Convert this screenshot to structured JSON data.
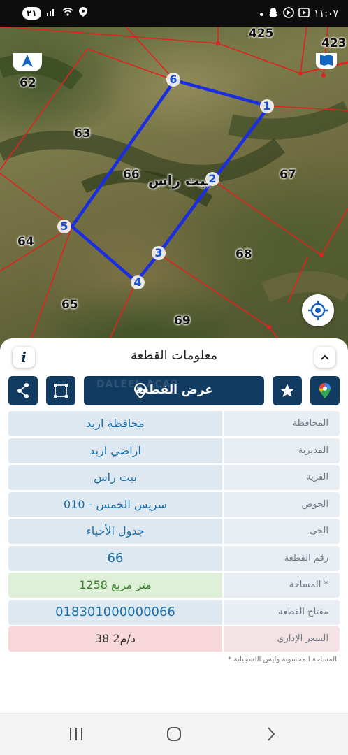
{
  "status_bar": {
    "notification_count": "٢١",
    "time": "١١:٠٧"
  },
  "map": {
    "parcels": [
      "62",
      "63",
      "64",
      "65",
      "66",
      "67",
      "68",
      "69",
      "425",
      "423"
    ],
    "village_label": "بيت راس",
    "vertices": [
      "1",
      "2",
      "3",
      "4",
      "5",
      "6"
    ],
    "highlight_color": "#1a2de0",
    "boundary_color": "#e0231e"
  },
  "sheet": {
    "title": "معلومات القطعة",
    "show_parcel_button": "عرض القطعة",
    "watermark": "DALEEL ACAR",
    "rows": [
      {
        "label": "المحافظة",
        "value": "محافظة اربد"
      },
      {
        "label": "المديرية",
        "value": "اراضي اربد"
      },
      {
        "label": "القرية",
        "value": "بيت راس"
      },
      {
        "label": "الحوض",
        "value": "سريس  الخمس - 010"
      },
      {
        "label": "الحي",
        "value": "جدول الأحياء"
      },
      {
        "label": "رقم القطعة",
        "value": "66"
      },
      {
        "label": "المساحة *",
        "value": "1258   متر مربع"
      },
      {
        "label": "مفتاح القطعة",
        "value": "018301000000066"
      },
      {
        "label": "السعر الإداري",
        "value": "38 د/م2"
      }
    ],
    "footnote": "* المساحة المحسوبة وليس التسجيلية"
  },
  "colors": {
    "primary": "#123b62",
    "value_text": "#1a6fa9",
    "area_bg": "#dff0d8",
    "price_bg": "#f8d7da"
  }
}
